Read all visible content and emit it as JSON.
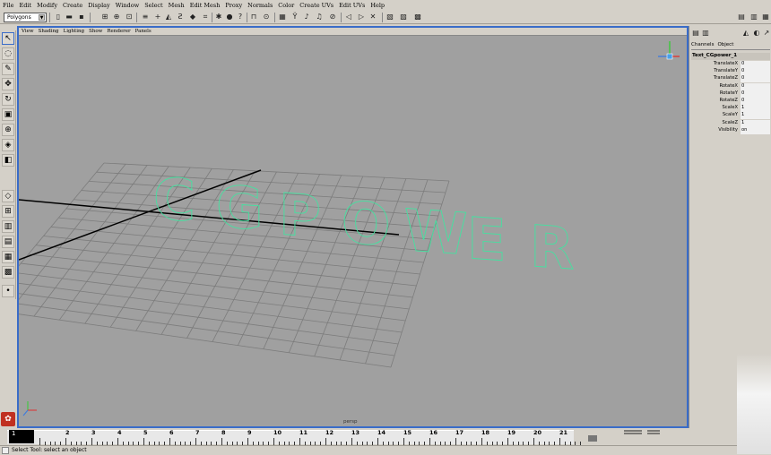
{
  "menubar": [
    "File",
    "Edit",
    "Modify",
    "Create",
    "Display",
    "Window",
    "Select",
    "Mesh",
    "Edit Mesh",
    "Proxy",
    "Normals",
    "Color",
    "Create UVs",
    "Edit UVs",
    "Help"
  ],
  "statusline": {
    "mode": "Polygons"
  },
  "panel_menu": [
    "View",
    "Shading",
    "Lighting",
    "Show",
    "Renderer",
    "Panels"
  ],
  "viewport": {
    "camera": "persp",
    "text_object": "CGPOWER",
    "grid_color": "#7c7c7c",
    "wire_color": "#46e0a0"
  },
  "channelbox": {
    "tabs": [
      "Channels",
      "Object"
    ],
    "object_name": "Text_CGpower_1",
    "channels": [
      {
        "label": "TranslateX",
        "value": "0"
      },
      {
        "label": "TranslateY",
        "value": "0"
      },
      {
        "label": "TranslateZ",
        "value": "0"
      },
      {
        "label": "RotateX",
        "value": "0"
      },
      {
        "label": "RotateY",
        "value": "0"
      },
      {
        "label": "RotateZ",
        "value": "0"
      },
      {
        "label": "ScaleX",
        "value": "1"
      },
      {
        "label": "ScaleY",
        "value": "1"
      },
      {
        "label": "ScaleZ",
        "value": "1"
      },
      {
        "label": "Visibility",
        "value": "on"
      }
    ]
  },
  "timeslider": {
    "current": "1",
    "ticks": [
      "1",
      "2",
      "3",
      "4",
      "5",
      "6",
      "7",
      "8",
      "9",
      "10",
      "11",
      "12",
      "13",
      "14",
      "15",
      "16",
      "17",
      "18",
      "19",
      "20",
      "21"
    ]
  },
  "helpline": {
    "text": "Select Tool: select an object"
  },
  "colors": {
    "accent": "#3a6cc8",
    "panel": "#d4d0c8",
    "viewport_bg": "#a0a0a0"
  }
}
